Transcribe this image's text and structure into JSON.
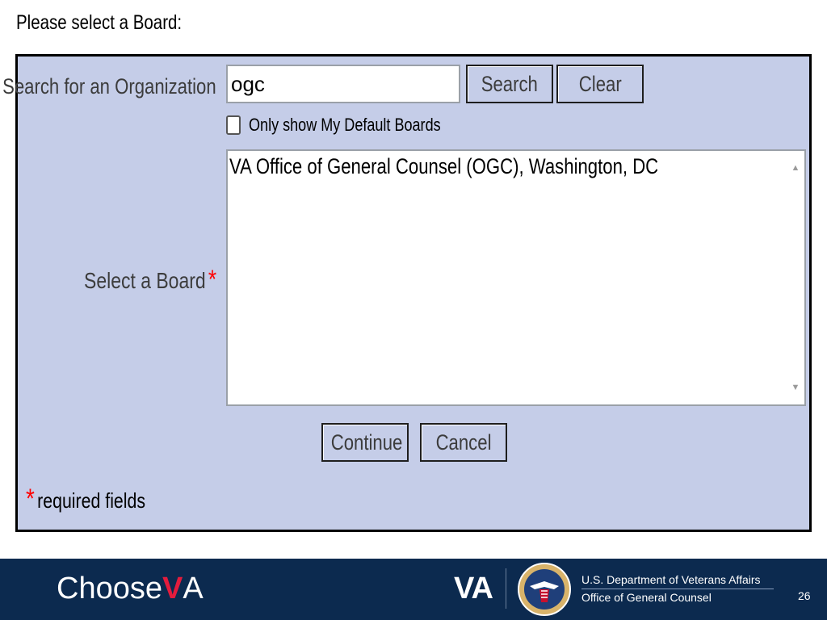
{
  "page": {
    "heading": "Please select a Board:"
  },
  "form": {
    "search_label": "Search for an Organization",
    "search_value": "ogc",
    "search_button": "Search",
    "clear_button": "Clear",
    "default_boards_label": "Only show My Default Boards",
    "default_boards_checked": false,
    "select_board_label": "Select a Board",
    "required_marker": "*",
    "board_options": [
      "VA Office of General Counsel (OGC), Washington, DC"
    ],
    "continue_button": "Continue",
    "cancel_button": "Cancel",
    "required_note": "required fields"
  },
  "footer": {
    "choose_logo_prefix": "Choose",
    "choose_logo_v": "V",
    "choose_logo_suffix": "A",
    "va_mark": "VA",
    "dept_name": "U.S. Department of Veterans Affairs",
    "office_name": "Office of General Counsel",
    "page_number": "26",
    "colors": {
      "background": "#0c2a4f",
      "accent_red": "#e31c3d"
    }
  },
  "colors": {
    "panel_background": "#c5cde8",
    "required_red": "#ff0000"
  }
}
